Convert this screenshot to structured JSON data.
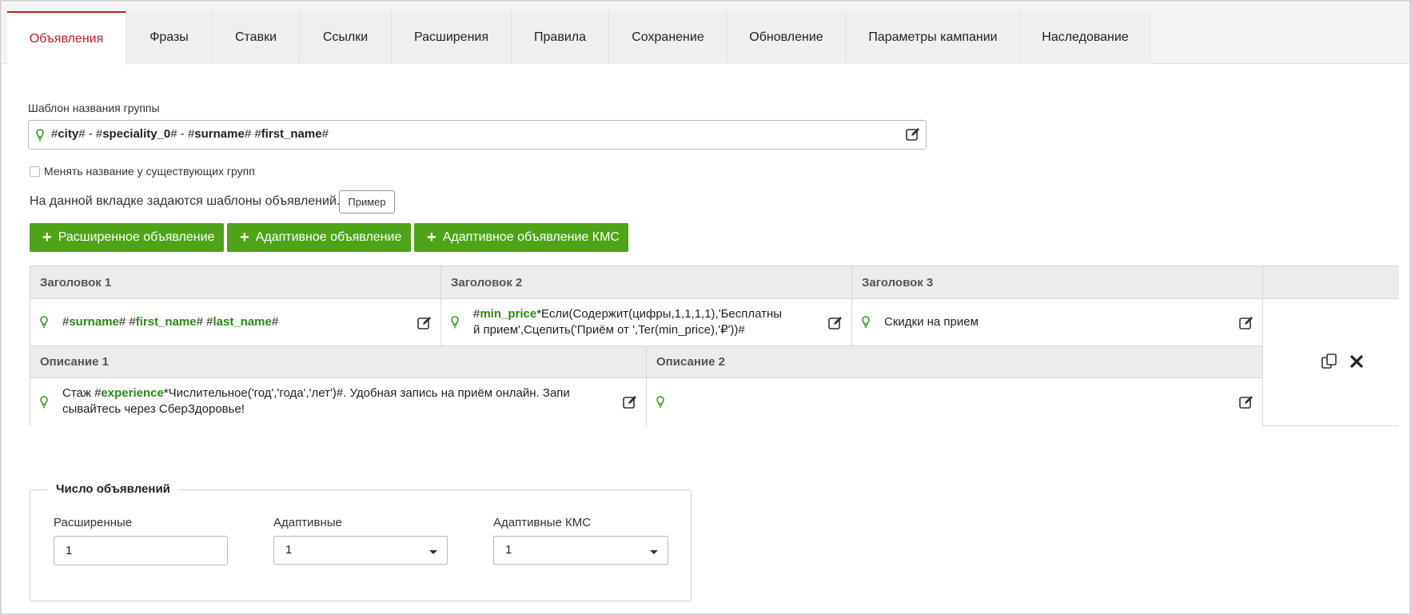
{
  "tabs": [
    "Объявления",
    "Фразы",
    "Ставки",
    "Ссылки",
    "Расширения",
    "Правила",
    "Сохранение",
    "Обновление",
    "Параметры кампании",
    "Наследование"
  ],
  "group_name": {
    "label": "Шаблон названия группы",
    "template": {
      "p1": "#",
      "v1": "city",
      "p2": "# - #",
      "v2": "speciality_0",
      "p3": "# - #",
      "v3": "surname",
      "p4": "# #",
      "v4": "first_name",
      "p5": "#"
    }
  },
  "rename_checkbox": {
    "label": "Менять название у существующих групп",
    "checked": false
  },
  "info": {
    "text": "На данной вкладке задаются шаблоны объявлений.",
    "example_button": "Пример"
  },
  "add_buttons": {
    "extended": "Расширенное объявление",
    "adaptive": "Адаптивное объявление",
    "adaptive_kms": "Адаптивное объявление КМС"
  },
  "ad": {
    "headers": {
      "h1": "Заголовок 1",
      "h2": "Заголовок 2",
      "h3": "Заголовок 3",
      "d1": "Описание 1",
      "d2": "Описание 2"
    },
    "h1": {
      "p1": "#",
      "v1": "surname",
      "p2": "# #",
      "v2": "first_name",
      "p3": "# #",
      "v3": "last_name",
      "p4": "#"
    },
    "h2": {
      "p1": "#",
      "v1": "min_price",
      "line1": "*Если(Содержит(цифры,1,1,1,1),'Бесплатны",
      "line2": "й прием',Сцепить('Приём от ',Ter(min_price),'₽'))#"
    },
    "h3": {
      "text": "Скидки на прием"
    },
    "d1": {
      "p1": "Стаж #",
      "v1": "experience",
      "line1": "*Числительное('год','года','лет')#. Удобная запись на приём онлайн. Запи",
      "line2": "сывайтесь через СберЗдоровье!"
    },
    "d2": {
      "text": ""
    }
  },
  "counts": {
    "title": "Число объявлений",
    "extended": {
      "label": "Расширенные",
      "value": "1"
    },
    "adaptive": {
      "label": "Адаптивные",
      "value": "1"
    },
    "adaptive_kms": {
      "label": "Адаптивные КМС",
      "value": "1"
    }
  },
  "colors": {
    "accent_tab": "#c81e1e",
    "button_green": "#4ea416",
    "variable_green": "#2a8a14",
    "bulb_green": "#3a9a1a"
  },
  "icons": [
    "lightbulb-icon",
    "edit-icon",
    "copy-icon",
    "delete-icon",
    "plus-icon",
    "caret-down-icon"
  ]
}
